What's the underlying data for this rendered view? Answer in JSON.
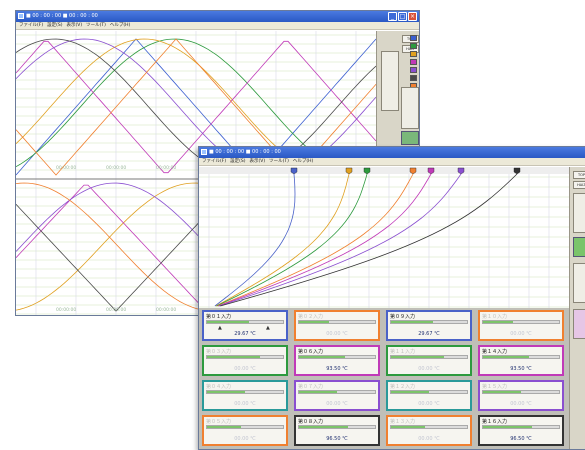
{
  "windows": [
    {
      "title": "■ 00 : 00 : 00  ■ 00 : 00 : 00",
      "menu": [
        "ファイル(F)",
        "設定(S)",
        "表示(V)",
        "ツール(T)",
        "ヘルプ(H)"
      ],
      "side_buttons": [
        "TOP",
        "HALT"
      ],
      "swatch_colors": [
        "#3c5fd0",
        "#2d9a3e",
        "#e0a020",
        "#c03ab8",
        "#8a4fd0",
        "#4a4a4a",
        "#f08030"
      ],
      "time_labels": [
        "00:00:00",
        "00:00:00",
        "00:00:00",
        "00:00:00",
        "00:00:00",
        "00:00:00"
      ]
    },
    {
      "title": "■ 00 : 00 : 00  ■ 00 : 00 : 00",
      "menu": [
        "ファイル(F)",
        "設定(S)",
        "表示(V)",
        "ツール(T)",
        "ヘルプ(H)"
      ],
      "side_buttons": [
        "TOP",
        "HALT"
      ],
      "marker_colors": [
        "#4a62c8",
        "#e0a020",
        "#2d9a3e",
        "#f08030",
        "#c03ab8",
        "#8a4fd0",
        "#333333"
      ]
    }
  ],
  "panels": [
    {
      "title": "第０１入力",
      "value": "29.67 ℃",
      "color": "#4a62c8",
      "faint": false,
      "pins": true,
      "fill": 0.55
    },
    {
      "title": "第０２入力",
      "value": "00.00 ℃",
      "color": "#f08030",
      "faint": true,
      "pins": false,
      "fill": 0.4
    },
    {
      "title": "第０９入力",
      "value": "29.67 ℃",
      "color": "#4a62c8",
      "faint": false,
      "pins": false,
      "fill": 0.55
    },
    {
      "title": "第１０入力",
      "value": "00.00 ℃",
      "color": "#f08030",
      "faint": true,
      "pins": false,
      "fill": 0.4
    },
    {
      "title": "第０３入力",
      "value": "00.00 ℃",
      "color": "#2d9a3e",
      "faint": true,
      "pins": false,
      "fill": 0.7
    },
    {
      "title": "第０６入力",
      "value": "93.50 ℃",
      "color": "#c03ab8",
      "faint": false,
      "pins": false,
      "fill": 0.6
    },
    {
      "title": "第１１入力",
      "value": "00.00 ℃",
      "color": "#2d9a3e",
      "faint": true,
      "pins": false,
      "fill": 0.7
    },
    {
      "title": "第１４入力",
      "value": "93.50 ℃",
      "color": "#c03ab8",
      "faint": false,
      "pins": false,
      "fill": 0.6
    },
    {
      "title": "第０４入力",
      "value": "00.00 ℃",
      "color": "#2a9a9a",
      "faint": true,
      "pins": false,
      "fill": 0.5
    },
    {
      "title": "第０７入力",
      "value": "00.00 ℃",
      "color": "#8a4fd0",
      "faint": true,
      "pins": false,
      "fill": 0.5
    },
    {
      "title": "第１２入力",
      "value": "00.00 ℃",
      "color": "#2a9a9a",
      "faint": true,
      "pins": false,
      "fill": 0.5
    },
    {
      "title": "第１５入力",
      "value": "00.00 ℃",
      "color": "#8a4fd0",
      "faint": true,
      "pins": false,
      "fill": 0.5
    },
    {
      "title": "第０５入力",
      "value": "00.00 ℃",
      "color": "#f08030",
      "faint": true,
      "pins": false,
      "fill": 0.45
    },
    {
      "title": "第０８入力",
      "value": "96.50 ℃",
      "color": "#333333",
      "faint": false,
      "pins": false,
      "fill": 0.65
    },
    {
      "title": "第１３入力",
      "value": "00.00 ℃",
      "color": "#f08030",
      "faint": true,
      "pins": false,
      "fill": 0.45
    },
    {
      "title": "第１６入力",
      "value": "96.50 ℃",
      "color": "#333333",
      "faint": false,
      "pins": false,
      "fill": 0.65
    }
  ]
}
